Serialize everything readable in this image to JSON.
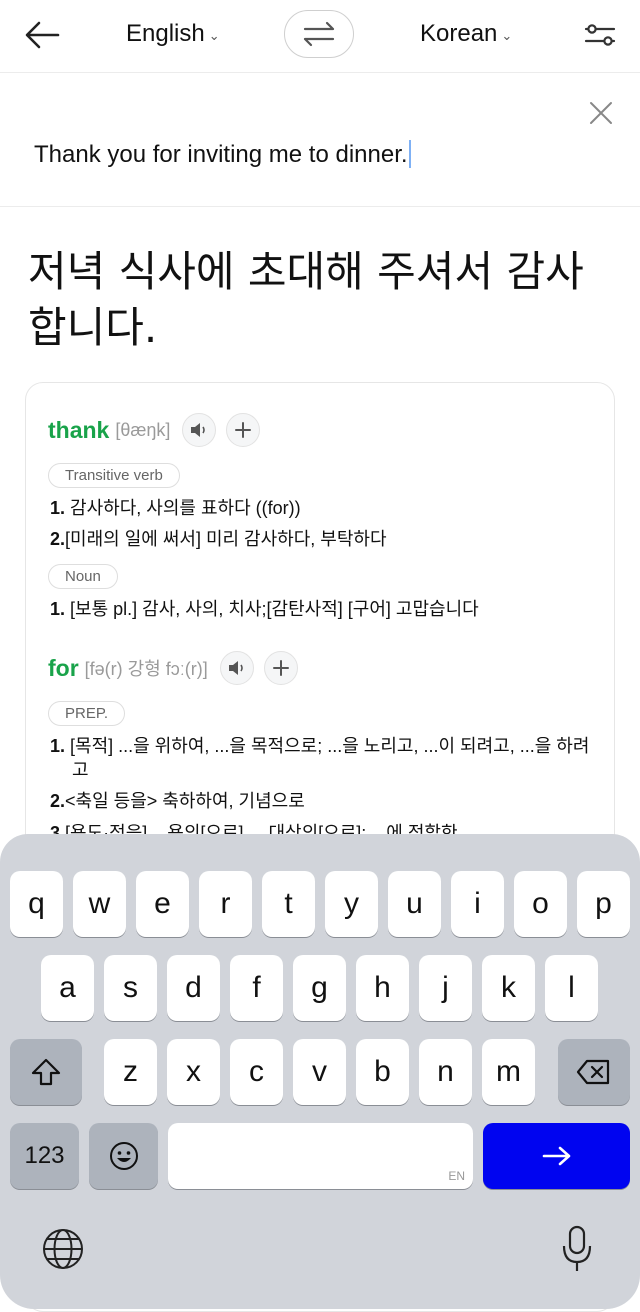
{
  "header": {
    "source_lang": "English",
    "target_lang": "Korean"
  },
  "input": {
    "text": "Thank you for inviting me to dinner."
  },
  "result": {
    "text": "저녁 식사에 초대해 주셔서 감사합니다."
  },
  "dictionary": {
    "entries": [
      {
        "word": "thank",
        "phonetic": "[θæŋk]",
        "senses": [
          {
            "pos": "Transitive verb",
            "defs": [
              {
                "num": "1.",
                "text": "감사하다, 사의를 표하다 ((for))"
              },
              {
                "num": "2.",
                "text": "[미래의 일에 써서] 미리 감사하다, 부탁하다"
              }
            ]
          },
          {
            "pos": "Noun",
            "defs": [
              {
                "num": "1.",
                "text": "[보통 pl.] 감사, 사의, 치사;[감탄사적] [구어] 고맙습니다"
              }
            ]
          }
        ]
      },
      {
        "word": "for",
        "phonetic": "[fə(r) 강형 fɔː(r)]",
        "senses": [
          {
            "pos": "PREP.",
            "defs": [
              {
                "num": "1.",
                "text": "[목적] ...을 위하여, ...을 목적으로; ...을 노리고, ...이 되려고, ...을 하려고"
              },
              {
                "num": "2.",
                "text": "<축일 등을> 축하하여, 기념으로"
              },
              {
                "num": "3.",
                "text": "[용도·적응] ...용의[으로], ...대상의[으로]; ...에 적합한"
              }
            ]
          }
        ]
      }
    ]
  },
  "keyboard": {
    "row1": [
      "q",
      "w",
      "e",
      "r",
      "t",
      "y",
      "u",
      "i",
      "o",
      "p"
    ],
    "row2": [
      "a",
      "s",
      "d",
      "f",
      "g",
      "h",
      "j",
      "k",
      "l"
    ],
    "row3": [
      "z",
      "x",
      "c",
      "v",
      "b",
      "n",
      "m"
    ],
    "numbers_label": "123",
    "space_hint": "EN",
    "go_color": "#0004f0"
  },
  "icons": {
    "back": "arrow-left-icon",
    "swap": "swap-arrows-icon",
    "settings": "sliders-icon",
    "clear": "close-icon",
    "speaker": "speaker-icon",
    "add": "plus-icon",
    "shift": "shift-icon",
    "delete": "backspace-icon",
    "emoji": "emoji-icon",
    "return": "arrow-right-icon",
    "globe": "globe-icon",
    "mic": "microphone-icon"
  }
}
